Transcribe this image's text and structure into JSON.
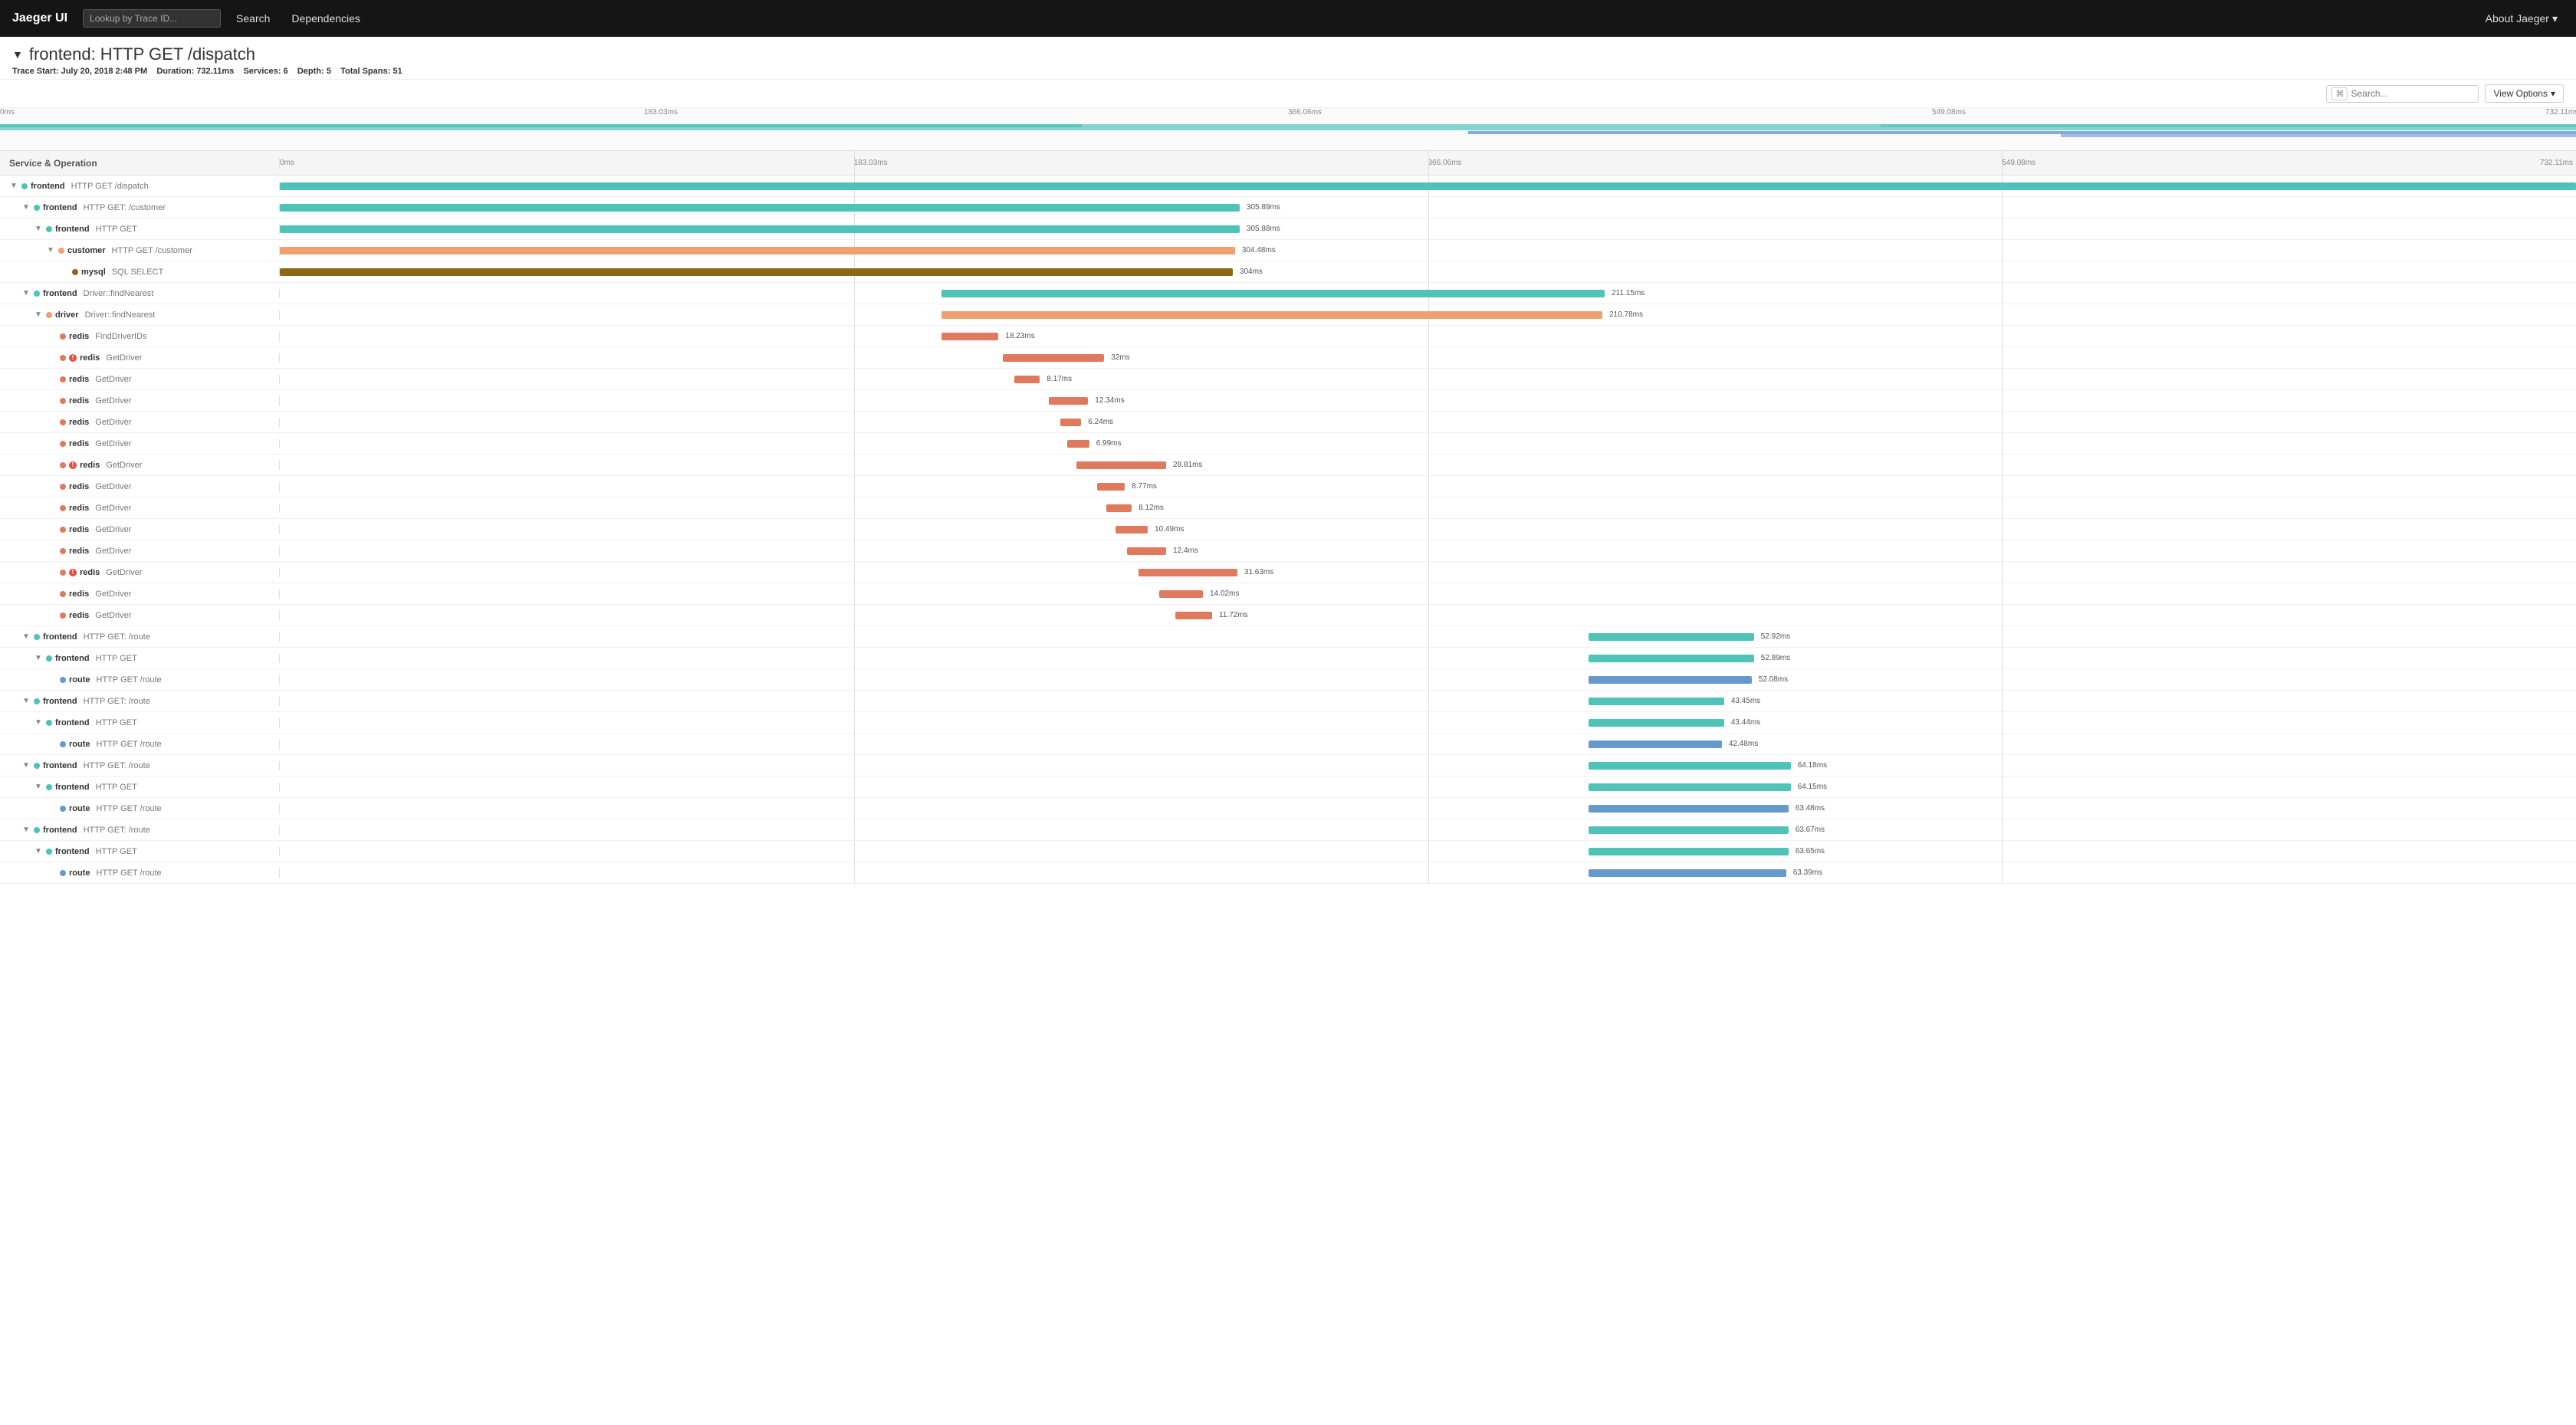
{
  "nav": {
    "brand": "Jaeger UI",
    "lookup_placeholder": "Lookup by Trace ID...",
    "search_label": "Search",
    "dependencies_label": "Dependencies",
    "about_label": "About Jaeger"
  },
  "trace": {
    "title": "frontend: HTTP GET /dispatch",
    "start_label": "Trace Start:",
    "start_value": "July 20, 2018 2:48 PM",
    "duration_label": "Duration:",
    "duration_value": "732.11ms",
    "services_label": "Services:",
    "services_value": "6",
    "depth_label": "Depth:",
    "depth_value": "5",
    "total_spans_label": "Total Spans:",
    "total_spans_value": "51"
  },
  "toolbar": {
    "search_placeholder": "Search...",
    "view_options_label": "View Options"
  },
  "timeline": {
    "ticks": [
      "0ms",
      "183.03ms",
      "366.06ms",
      "549.08ms",
      "732.11ms"
    ]
  },
  "col_header": {
    "service_label": "Service & Operation",
    "ticks": [
      "0ms",
      "183.03ms",
      "366.06ms",
      "549.08ms",
      "732.11ms"
    ]
  },
  "spans": [
    {
      "indent": 0,
      "expand": "▼",
      "service": "frontend",
      "op": "HTTP GET /dispatch",
      "color": "teal",
      "bar_left_pct": 0,
      "bar_width_pct": 100,
      "duration": "",
      "depth": 0
    },
    {
      "indent": 1,
      "expand": "▼",
      "service": "frontend",
      "op": "HTTP GET: /customer",
      "color": "teal",
      "bar_left_pct": 0,
      "bar_width_pct": 41.8,
      "duration": "305.89ms",
      "depth": 1
    },
    {
      "indent": 2,
      "expand": "▼",
      "service": "frontend",
      "op": "HTTP GET",
      "color": "teal",
      "bar_left_pct": 0,
      "bar_width_pct": 41.8,
      "duration": "305.88ms",
      "depth": 2
    },
    {
      "indent": 3,
      "expand": "▼",
      "service": "customer",
      "op": "HTTP GET /customer",
      "color": "orange",
      "bar_left_pct": 0,
      "bar_width_pct": 41.6,
      "duration": "304.48ms",
      "depth": 3
    },
    {
      "indent": 4,
      "expand": "",
      "service": "mysql",
      "op": "SQL SELECT",
      "color": "brown",
      "bar_left_pct": 0,
      "bar_width_pct": 41.5,
      "duration": "304ms",
      "depth": 4
    },
    {
      "indent": 1,
      "expand": "▼",
      "service": "frontend",
      "op": "Driver::findNearest",
      "color": "teal",
      "bar_left_pct": 28.8,
      "bar_width_pct": 28.9,
      "duration": "211.15ms",
      "depth": 1
    },
    {
      "indent": 2,
      "expand": "▼",
      "service": "driver",
      "op": "Driver::findNearest",
      "color": "orange",
      "bar_left_pct": 28.8,
      "bar_width_pct": 28.8,
      "duration": "210.78ms",
      "depth": 2
    },
    {
      "indent": 3,
      "expand": "",
      "service": "redis",
      "op": "FindDriverIDs",
      "color": "salmon",
      "bar_left_pct": 28.8,
      "bar_width_pct": 2.5,
      "duration": "18.23ms",
      "depth": 3
    },
    {
      "indent": 3,
      "expand": "",
      "service": "redis",
      "op": "GetDriver",
      "color": "salmon",
      "bar_left_pct": 31.5,
      "bar_width_pct": 4.4,
      "duration": "32ms",
      "depth": 3,
      "error": true
    },
    {
      "indent": 3,
      "expand": "",
      "service": "redis",
      "op": "GetDriver",
      "color": "salmon",
      "bar_left_pct": 32.0,
      "bar_width_pct": 1.1,
      "duration": "8.17ms",
      "depth": 3
    },
    {
      "indent": 3,
      "expand": "",
      "service": "redis",
      "op": "GetDriver",
      "color": "salmon",
      "bar_left_pct": 33.5,
      "bar_width_pct": 1.7,
      "duration": "12.34ms",
      "depth": 3
    },
    {
      "indent": 3,
      "expand": "",
      "service": "redis",
      "op": "GetDriver",
      "color": "salmon",
      "bar_left_pct": 34.0,
      "bar_width_pct": 0.9,
      "duration": "6.24ms",
      "depth": 3
    },
    {
      "indent": 3,
      "expand": "",
      "service": "redis",
      "op": "GetDriver",
      "color": "salmon",
      "bar_left_pct": 34.3,
      "bar_width_pct": 0.95,
      "duration": "6.99ms",
      "depth": 3
    },
    {
      "indent": 3,
      "expand": "",
      "service": "redis",
      "op": "GetDriver",
      "color": "salmon",
      "bar_left_pct": 34.7,
      "bar_width_pct": 3.9,
      "duration": "28.81ms",
      "depth": 3,
      "error": true
    },
    {
      "indent": 3,
      "expand": "",
      "service": "redis",
      "op": "GetDriver",
      "color": "salmon",
      "bar_left_pct": 35.6,
      "bar_width_pct": 1.2,
      "duration": "8.77ms",
      "depth": 3
    },
    {
      "indent": 3,
      "expand": "",
      "service": "redis",
      "op": "GetDriver",
      "color": "salmon",
      "bar_left_pct": 36.0,
      "bar_width_pct": 1.1,
      "duration": "8.12ms",
      "depth": 3
    },
    {
      "indent": 3,
      "expand": "",
      "service": "redis",
      "op": "GetDriver",
      "color": "salmon",
      "bar_left_pct": 36.4,
      "bar_width_pct": 1.4,
      "duration": "10.49ms",
      "depth": 3
    },
    {
      "indent": 3,
      "expand": "",
      "service": "redis",
      "op": "GetDriver",
      "color": "salmon",
      "bar_left_pct": 36.9,
      "bar_width_pct": 1.7,
      "duration": "12.4ms",
      "depth": 3
    },
    {
      "indent": 3,
      "expand": "",
      "service": "redis",
      "op": "GetDriver",
      "color": "salmon",
      "bar_left_pct": 37.4,
      "bar_width_pct": 4.3,
      "duration": "31.63ms",
      "depth": 3,
      "error": true
    },
    {
      "indent": 3,
      "expand": "",
      "service": "redis",
      "op": "GetDriver",
      "color": "salmon",
      "bar_left_pct": 38.3,
      "bar_width_pct": 1.9,
      "duration": "14.02ms",
      "depth": 3
    },
    {
      "indent": 3,
      "expand": "",
      "service": "redis",
      "op": "GetDriver",
      "color": "salmon",
      "bar_left_pct": 39.0,
      "bar_width_pct": 1.6,
      "duration": "11.72ms",
      "depth": 3
    },
    {
      "indent": 1,
      "expand": "▼",
      "service": "frontend",
      "op": "HTTP GET: /route",
      "color": "teal",
      "bar_left_pct": 57.0,
      "bar_width_pct": 7.2,
      "duration": "52.92ms",
      "depth": 1
    },
    {
      "indent": 2,
      "expand": "▼",
      "service": "frontend",
      "op": "HTTP GET",
      "color": "teal",
      "bar_left_pct": 57.0,
      "bar_width_pct": 7.2,
      "duration": "52.89ms",
      "depth": 2
    },
    {
      "indent": 3,
      "expand": "",
      "service": "route",
      "op": "HTTP GET /route",
      "color": "blue",
      "bar_left_pct": 57.0,
      "bar_width_pct": 7.1,
      "duration": "52.08ms",
      "depth": 3
    },
    {
      "indent": 1,
      "expand": "▼",
      "service": "frontend",
      "op": "HTTP GET: /route",
      "color": "teal",
      "bar_left_pct": 57.0,
      "bar_width_pct": 5.9,
      "duration": "43.45ms",
      "depth": 1
    },
    {
      "indent": 2,
      "expand": "▼",
      "service": "frontend",
      "op": "HTTP GET",
      "color": "teal",
      "bar_left_pct": 57.0,
      "bar_width_pct": 5.9,
      "duration": "43.44ms",
      "depth": 2
    },
    {
      "indent": 3,
      "expand": "",
      "service": "route",
      "op": "HTTP GET /route",
      "color": "blue",
      "bar_left_pct": 57.0,
      "bar_width_pct": 5.8,
      "duration": "42.48ms",
      "depth": 3
    },
    {
      "indent": 1,
      "expand": "▼",
      "service": "frontend",
      "op": "HTTP GET: /route",
      "color": "teal",
      "bar_left_pct": 57.0,
      "bar_width_pct": 8.8,
      "duration": "64.18ms",
      "depth": 1
    },
    {
      "indent": 2,
      "expand": "▼",
      "service": "frontend",
      "op": "HTTP GET",
      "color": "teal",
      "bar_left_pct": 57.0,
      "bar_width_pct": 8.8,
      "duration": "64.15ms",
      "depth": 2
    },
    {
      "indent": 3,
      "expand": "",
      "service": "route",
      "op": "HTTP GET /route",
      "color": "blue",
      "bar_left_pct": 57.0,
      "bar_width_pct": 8.7,
      "duration": "63.48ms",
      "depth": 3
    },
    {
      "indent": 1,
      "expand": "▼",
      "service": "frontend",
      "op": "HTTP GET: /route",
      "color": "teal",
      "bar_left_pct": 57.0,
      "bar_width_pct": 8.7,
      "duration": "63.67ms",
      "depth": 1
    },
    {
      "indent": 2,
      "expand": "▼",
      "service": "frontend",
      "op": "HTTP GET",
      "color": "teal",
      "bar_left_pct": 57.0,
      "bar_width_pct": 8.7,
      "duration": "63.65ms",
      "depth": 2
    },
    {
      "indent": 3,
      "expand": "",
      "service": "route",
      "op": "HTTP GET /route",
      "color": "blue",
      "bar_left_pct": 57.0,
      "bar_width_pct": 8.6,
      "duration": "63.39ms",
      "depth": 3
    }
  ],
  "service_colors": {
    "frontend": "#4fc3b8",
    "customer": "#f0a070",
    "mysql": "#8b6914",
    "driver": "#f0a070",
    "redis": "#e07a5f",
    "route": "#6699cc"
  }
}
